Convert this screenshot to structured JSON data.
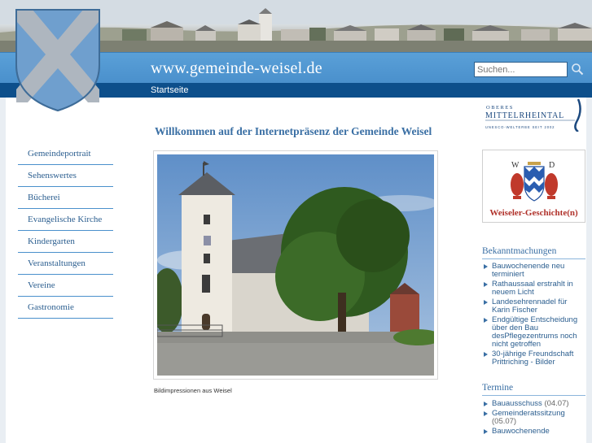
{
  "header": {
    "site_title": "www.gemeinde-weisel.de",
    "search_placeholder": "Suchen...",
    "search_icon": "magnifier-icon"
  },
  "nav": {
    "home_label": "Startseite"
  },
  "sidebar": {
    "items": [
      {
        "label": "Gemeindeportrait"
      },
      {
        "label": "Sehenswertes"
      },
      {
        "label": "Bücherei"
      },
      {
        "label": "Evangelische Kirche"
      },
      {
        "label": "Kindergarten"
      },
      {
        "label": "Veranstaltungen"
      },
      {
        "label": "Vereine"
      },
      {
        "label": "Gastronomie"
      }
    ]
  },
  "main": {
    "welcome_text": "Willkommen auf der Internetpräsenz der Gemeinde Weisel",
    "photo_caption": "Bildimpressionen aus Weisel"
  },
  "right": {
    "logo": {
      "line1": "OBERES",
      "line2": "MITTELRHEINTAL",
      "line3": "UNESCO-WELTERBE SEIT 2002"
    },
    "history": {
      "label": "Weiseler-Geschichte(n)",
      "crest_letters": [
        "W",
        "D"
      ]
    },
    "announcements": {
      "title": "Bekanntmachungen",
      "items": [
        {
          "text": "Bauwochenende neu terminiert"
        },
        {
          "text": "Rathaussaal erstrahlt in neuem Licht"
        },
        {
          "text": "Landesehrennadel für Karin Fischer"
        },
        {
          "text": "Endgültige Entscheidung über den Bau desPflegezentrums noch nicht getroffen"
        },
        {
          "text": "30-jährige Freundschaft Prittriching - Bilder"
        }
      ]
    },
    "events": {
      "title": "Termine",
      "items": [
        {
          "text": "Bauausschuss",
          "date": "(04.07)"
        },
        {
          "text": "Gemeinderatssitzung",
          "date": "(05.07)"
        },
        {
          "text": "Bauwochenende",
          "date": ""
        }
      ]
    }
  },
  "colors": {
    "header_blue": "#4a90cc",
    "nav_dark_blue": "#0d4f8b",
    "link_blue": "#2b5e8f",
    "heading_blue": "#3a6fa4",
    "history_red": "#b0312a"
  }
}
